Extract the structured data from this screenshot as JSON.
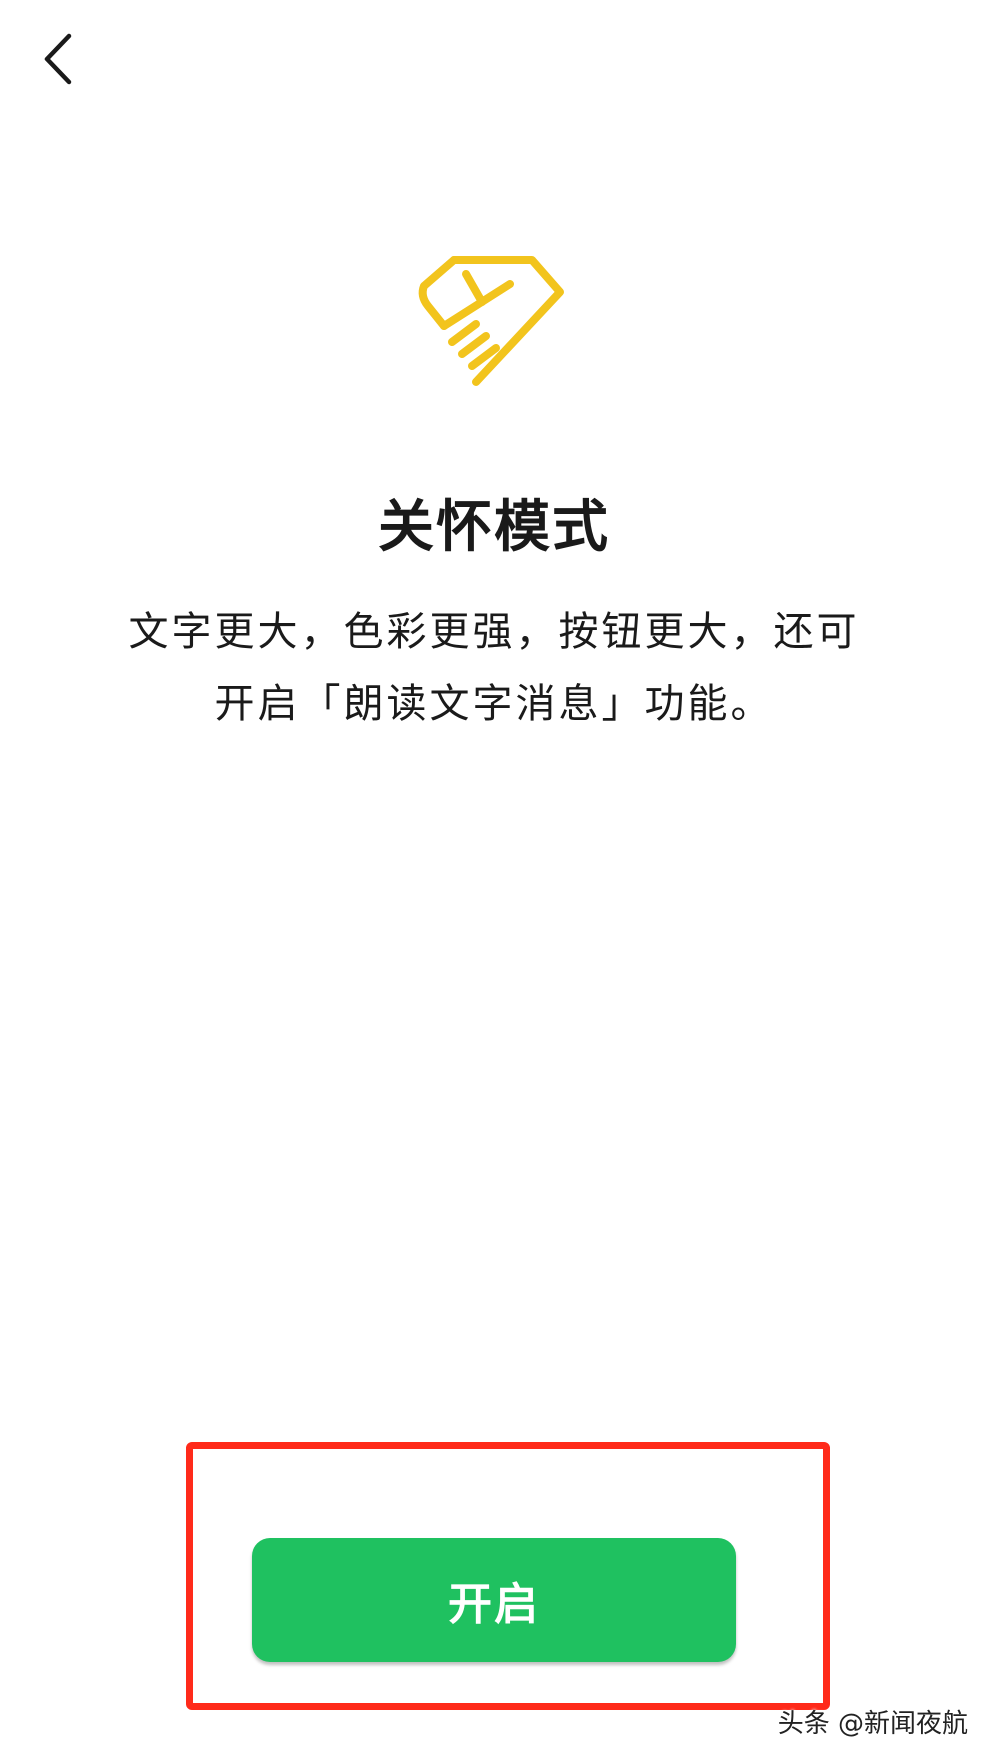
{
  "header": {
    "back_icon": "chevron-left-icon"
  },
  "hero": {
    "icon": "care-heart-hands-icon",
    "icon_color": "#f2c41d"
  },
  "content": {
    "title": "关怀模式",
    "description_line1": "文字更大，色彩更强，按钮更大，还可",
    "description_line2": "开启「朗读文字消息」功能。"
  },
  "actions": {
    "enable_label": "开启",
    "enable_color": "#1fc160",
    "highlight_color": "#ff2a1a"
  },
  "watermark": {
    "text": "头条 @新闻夜航"
  }
}
